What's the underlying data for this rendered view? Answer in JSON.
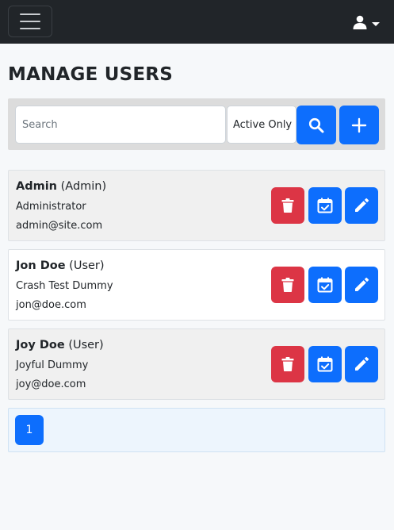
{
  "navbar": {
    "menu_icon": "hamburger-icon",
    "user_icon": "user-icon"
  },
  "page": {
    "title": "MANAGE USERS"
  },
  "search": {
    "placeholder": "Search",
    "value": "",
    "filter_selected": "Active Only",
    "search_icon": "search-icon",
    "add_icon": "plus-icon"
  },
  "users": [
    {
      "name": "Admin",
      "role": "(Admin)",
      "title": "Administrator",
      "email": "admin@site.com"
    },
    {
      "name": "Jon Doe",
      "role": "(User)",
      "title": "Crash Test Dummy",
      "email": "jon@doe.com"
    },
    {
      "name": "Joy Doe",
      "role": "(User)",
      "title": "Joyful Dummy",
      "email": "joy@doe.com"
    }
  ],
  "row_actions": {
    "delete_icon": "trash-icon",
    "schedule_icon": "calendar-check-icon",
    "edit_icon": "pencil-icon"
  },
  "pagination": {
    "current_page": "1"
  },
  "colors": {
    "primary": "#0d6efd",
    "danger": "#dc3545",
    "navbar": "#212529"
  }
}
